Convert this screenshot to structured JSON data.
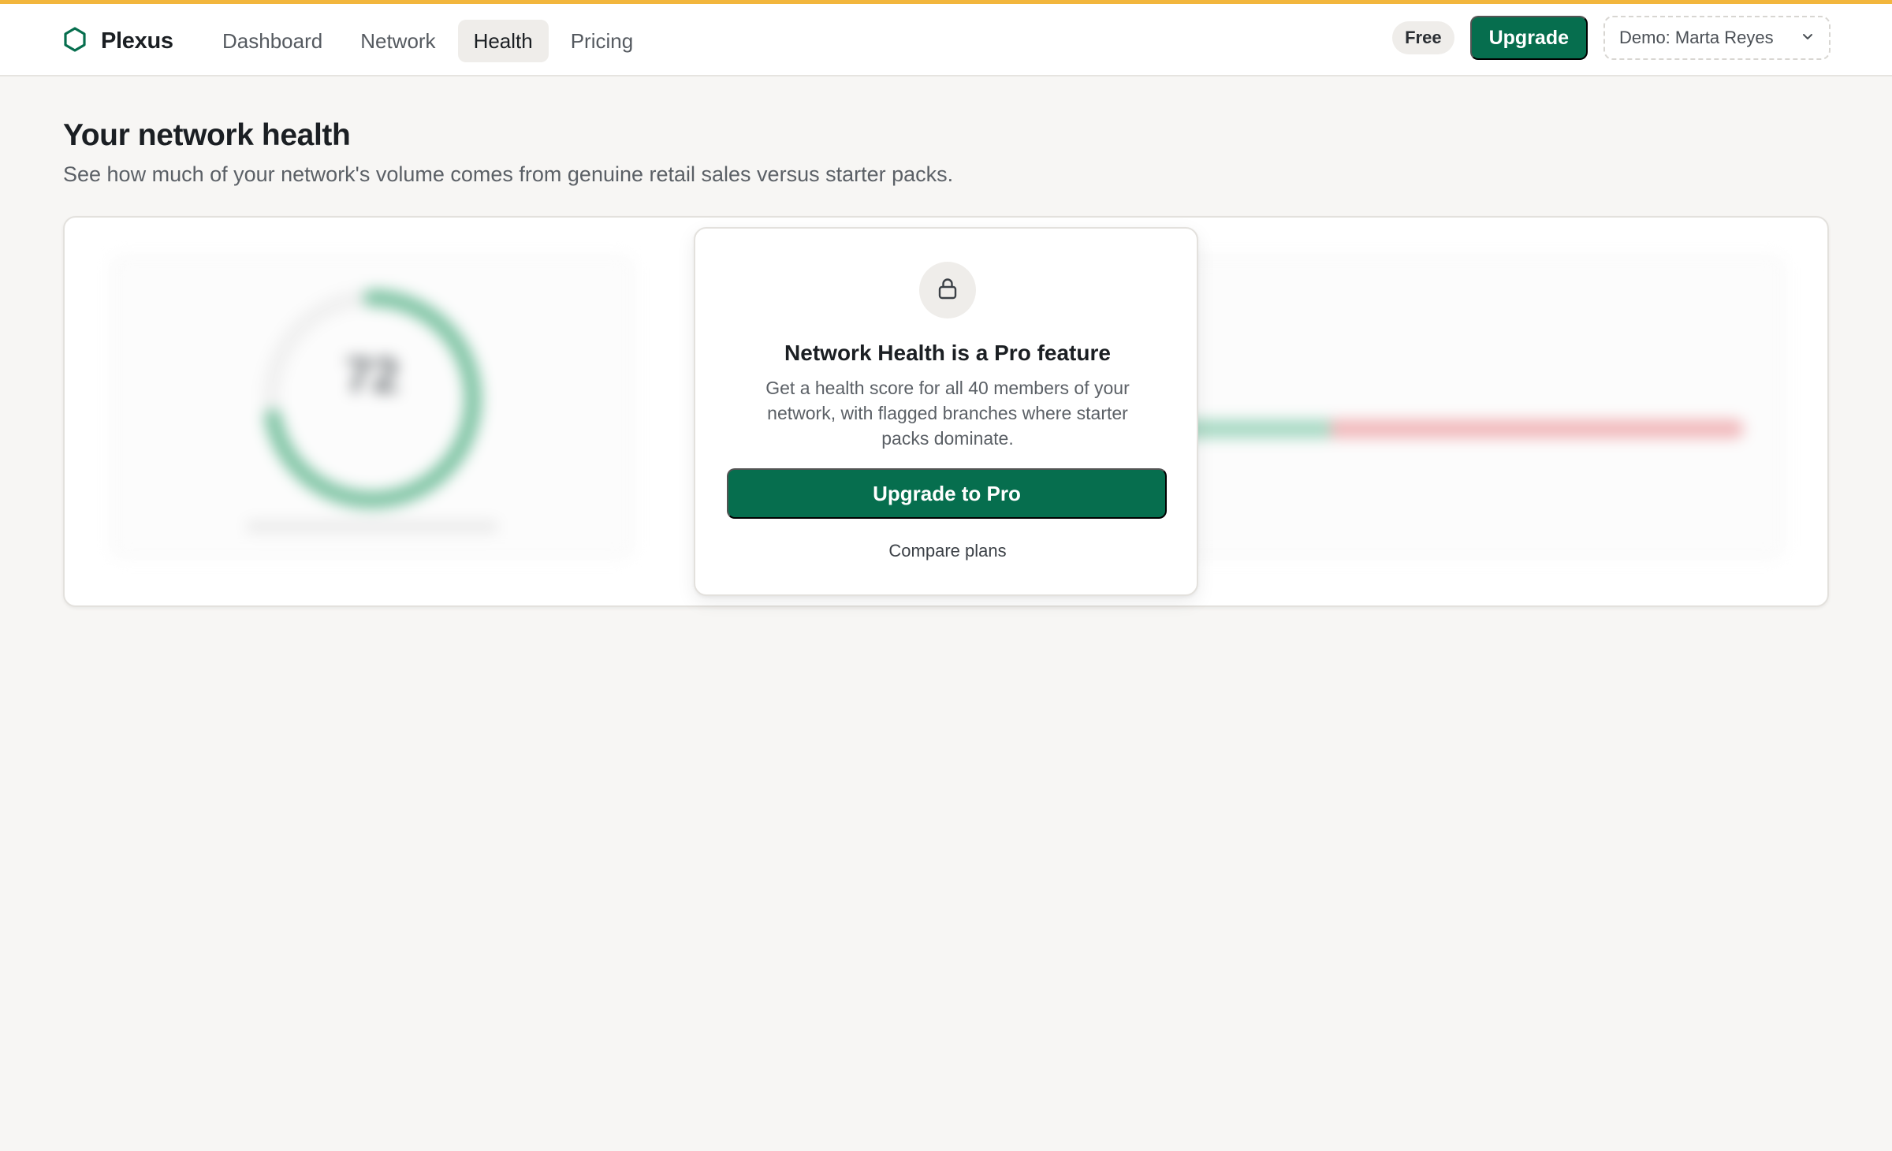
{
  "brand": {
    "name": "Plexus",
    "logo_icon": "hexagon-icon",
    "color": "#066e4e"
  },
  "nav": {
    "items": [
      {
        "label": "Dashboard",
        "active": false
      },
      {
        "label": "Network",
        "active": false
      },
      {
        "label": "Health",
        "active": true
      },
      {
        "label": "Pricing",
        "active": false
      }
    ]
  },
  "header_right": {
    "plan_badge": "Free",
    "upgrade_label": "Upgrade",
    "demo_user": "Demo: Marta Reyes",
    "demo_icon": "chevron-down-icon"
  },
  "page": {
    "title": "Your network health",
    "subtitle": "See how much of your network's volume comes from genuine retail sales versus starter packs."
  },
  "blurred_preview": {
    "score": "72",
    "retail_fraction": 0.54,
    "starter_fraction": 0.46
  },
  "paywall": {
    "icon": "lock-icon",
    "title": "Network Health is a Pro feature",
    "description": "Get a health score for all 40 members of your network, with flagged branches where starter packs dominate.",
    "cta_label": "Upgrade to Pro",
    "secondary_label": "Compare plans"
  },
  "colors": {
    "accent_bar": "#f2b63d",
    "primary": "#066e4e",
    "retail": "#a7d9c3",
    "starter": "#f1b8bb"
  }
}
